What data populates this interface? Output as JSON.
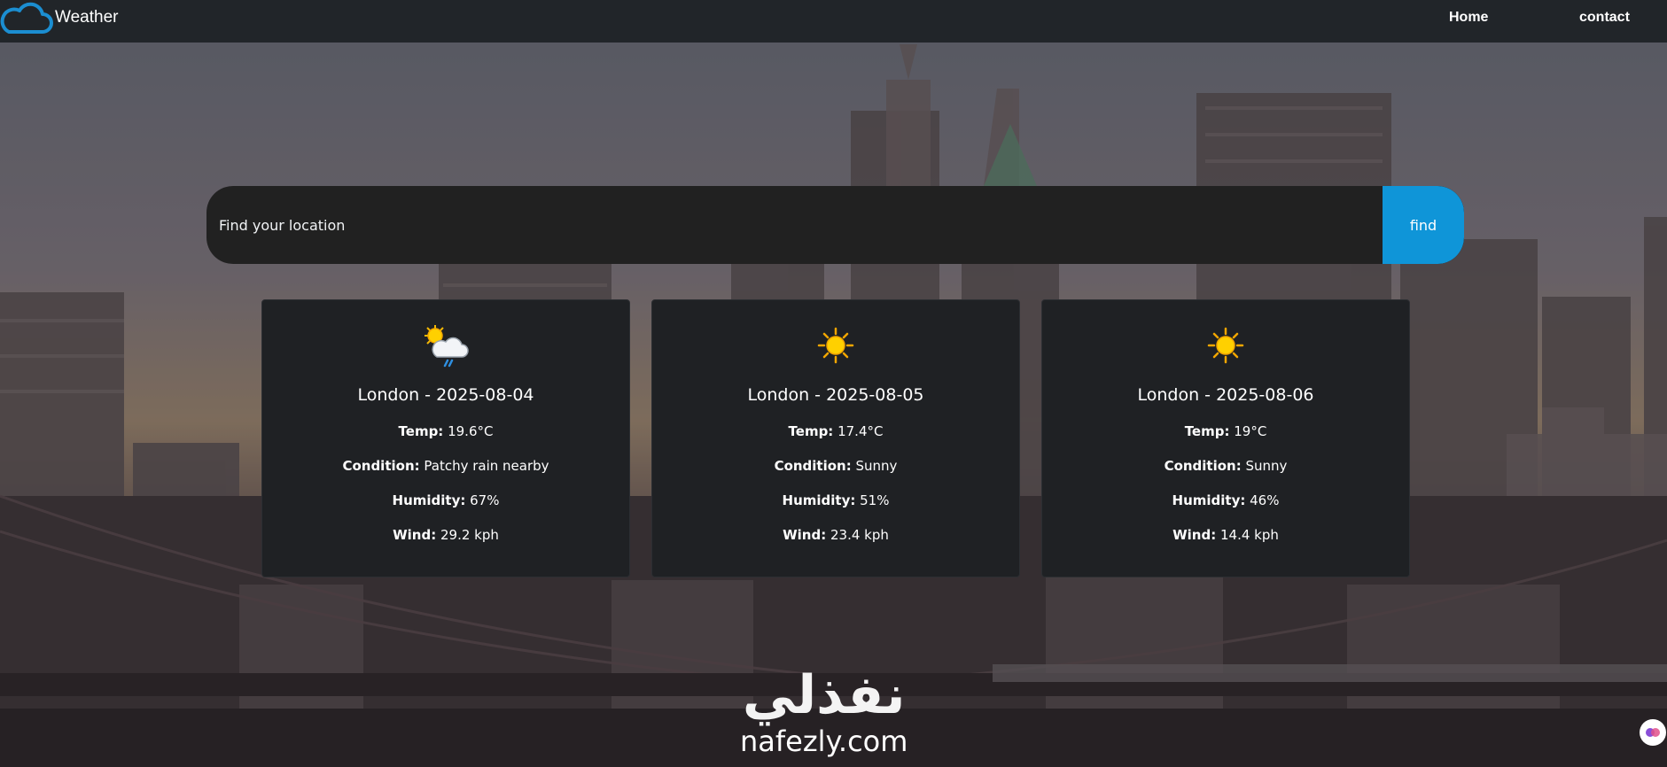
{
  "navbar": {
    "brand": "Weather",
    "brand_icon": "cloud-icon",
    "links": [
      "Home",
      "contact"
    ]
  },
  "search": {
    "placeholder": "Find your location",
    "button_label": "find"
  },
  "cards": [
    {
      "icon": "partly-cloudy-rain-icon",
      "title": "London - 2025-08-04",
      "temp_label": "Temp:",
      "temp": "19.6°C",
      "condition_label": "Condition:",
      "condition": "Patchy rain nearby",
      "humidity_label": "Humidity:",
      "humidity": "67%",
      "wind_label": "Wind:",
      "wind": "29.2 kph"
    },
    {
      "icon": "sun-icon",
      "title": "London - 2025-08-05",
      "temp_label": "Temp:",
      "temp": "17.4°C",
      "condition_label": "Condition:",
      "condition": "Sunny",
      "humidity_label": "Humidity:",
      "humidity": "51%",
      "wind_label": "Wind:",
      "wind": "23.4 kph"
    },
    {
      "icon": "sun-icon",
      "title": "London - 2025-08-06",
      "temp_label": "Temp:",
      "temp": "19°C",
      "condition_label": "Condition:",
      "condition": "Sunny",
      "humidity_label": "Humidity:",
      "humidity": "46%",
      "wind_label": "Wind:",
      "wind": "14.4 kph"
    }
  ],
  "watermark": {
    "arabic": "نفذلي",
    "latin": "nafezly.com"
  },
  "colors": {
    "navbar": "#212529",
    "search_bg": "#212121",
    "find_button": "#0f95d8",
    "card_bg": "#1f2124"
  }
}
